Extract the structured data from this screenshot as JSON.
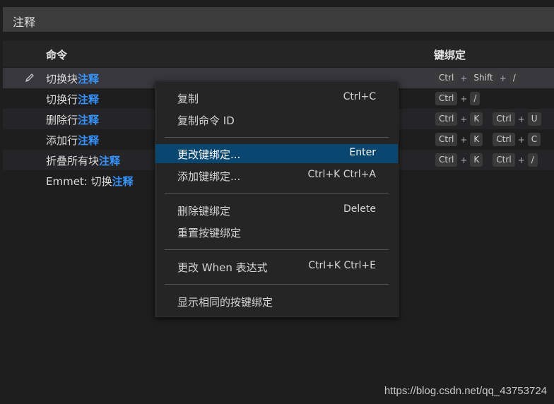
{
  "search": {
    "value": "注释"
  },
  "table": {
    "headers": {
      "command": "命令",
      "keybinding": "键绑定"
    },
    "rows": [
      {
        "prefix": "切换块",
        "highlight": "注释",
        "suffix": "",
        "keys": [
          [
            "Ctrl",
            "Shift",
            "/"
          ]
        ]
      },
      {
        "prefix": "切换行",
        "highlight": "注释",
        "suffix": "",
        "keys": [
          [
            "Ctrl",
            "/"
          ]
        ]
      },
      {
        "prefix": "删除行",
        "highlight": "注释",
        "suffix": "",
        "keys": [
          [
            "Ctrl",
            "K"
          ],
          [
            "Ctrl",
            "U"
          ]
        ]
      },
      {
        "prefix": "添加行",
        "highlight": "注释",
        "suffix": "",
        "keys": [
          [
            "Ctrl",
            "K"
          ],
          [
            "Ctrl",
            "C"
          ]
        ]
      },
      {
        "prefix": "折叠所有块",
        "highlight": "注释",
        "suffix": "",
        "keys": [
          [
            "Ctrl",
            "K"
          ],
          [
            "Ctrl",
            "/"
          ]
        ]
      },
      {
        "prefix": "Emmet: 切换",
        "highlight": "注释",
        "suffix": "",
        "keys": []
      }
    ]
  },
  "context_menu": {
    "items": [
      {
        "label": "复制",
        "shortcut": "Ctrl+C"
      },
      {
        "label": "复制命令 ID",
        "shortcut": ""
      },
      {
        "label": "更改键绑定...",
        "shortcut": "Enter"
      },
      {
        "label": "添加键绑定...",
        "shortcut": "Ctrl+K Ctrl+A"
      },
      {
        "label": "删除键绑定",
        "shortcut": "Delete"
      },
      {
        "label": "重置按键绑定",
        "shortcut": ""
      },
      {
        "label": "更改 When 表达式",
        "shortcut": "Ctrl+K Ctrl+E"
      },
      {
        "label": "显示相同的按键绑定",
        "shortcut": ""
      }
    ],
    "active_index": 2
  },
  "watermark": "https://blog.csdn.net/qq_43753724",
  "colors": {
    "highlight": "#3794ff",
    "menu_active": "#094771",
    "background": "#1e1e1e"
  }
}
